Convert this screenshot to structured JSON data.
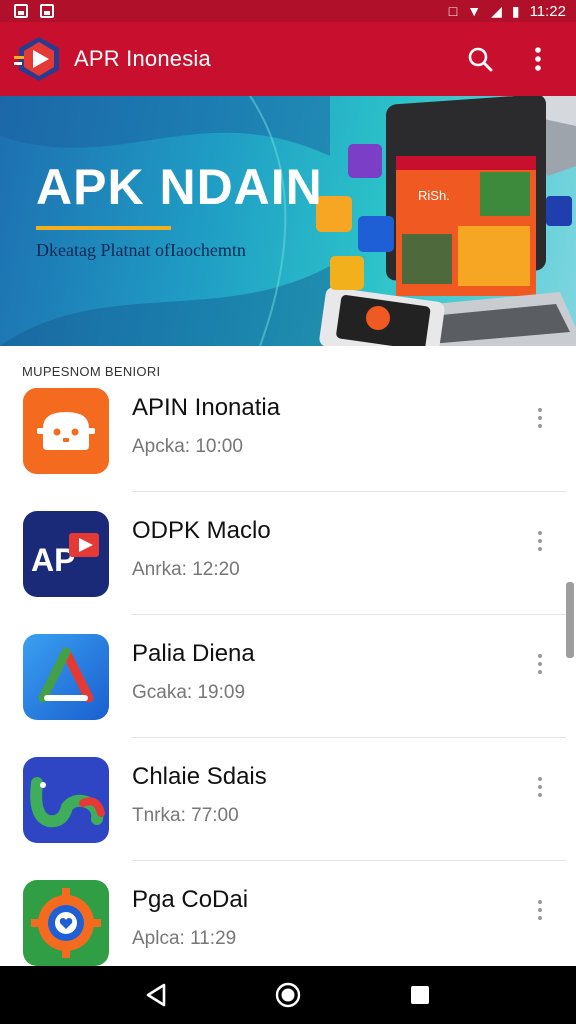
{
  "status_bar": {
    "time": "11:22"
  },
  "app_bar": {
    "title": "APR Inonesia",
    "search_icon": "search-icon",
    "menu_icon": "more-vert-icon"
  },
  "banner": {
    "title": "APK NDAIN",
    "subtitle": "Dkeatag Platnat ofIaochemtn",
    "screen_label": "RiSh.",
    "accent_color": "#f2b11c"
  },
  "section": {
    "header": "MUPESNOM BENIORI"
  },
  "items": [
    {
      "name": "APIN Inonatia",
      "sub": "Apcka: 10:00",
      "icon": "android-face-icon"
    },
    {
      "name": "ODPK Maclo",
      "sub": "Anrka: 12:20",
      "icon": "apk-logo-icon"
    },
    {
      "name": "Palia Diena",
      "sub": "Gcaka: 19:09",
      "icon": "triangle-logo-icon"
    },
    {
      "name": "Chlaie Sdais",
      "sub": "Tnrka: 77:00",
      "icon": "creature-icon"
    },
    {
      "name": "Pga CoDai",
      "sub": "Aplca: 11:29",
      "icon": "gear-heart-icon"
    }
  ],
  "colors": {
    "primary": "#c8102e",
    "status": "#b0102a"
  }
}
